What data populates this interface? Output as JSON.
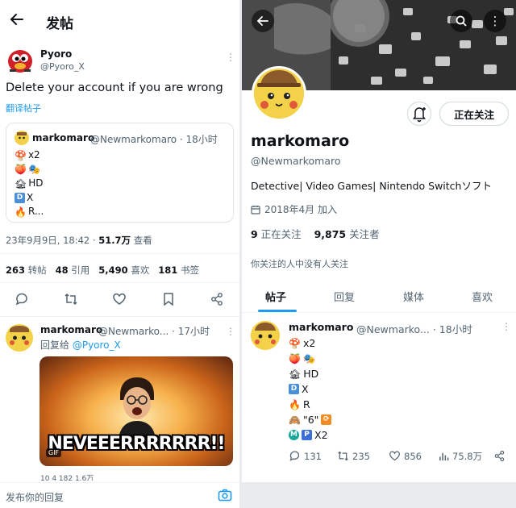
{
  "left": {
    "header": {
      "title": "发帖"
    },
    "tweet": {
      "name": "Pyoro",
      "handle": "@Pyoro_X",
      "text": "Delete your account if you are wrong",
      "translate": "翻译帖子"
    },
    "quote": {
      "name": "markomaro",
      "handle": "@Newmarkomaro · 18小时",
      "lines": [
        {
          "icons": [
            "mushroom"
          ],
          "text": "x2"
        },
        {
          "icons": [
            "peach",
            "masks"
          ],
          "text": ""
        },
        {
          "icons": [
            "house"
          ],
          "text": "HD"
        },
        {
          "icons": [
            "box-d"
          ],
          "text": "X"
        },
        {
          "icons": [
            "fire"
          ],
          "text": "R..."
        }
      ]
    },
    "meta": {
      "datetime": "23年9月9日, 18:42 · ",
      "views": "51.7万",
      "views_label": " 查看"
    },
    "stats": {
      "retweets": "263",
      "retweets_label": " 转帖",
      "quotes": "48",
      "quotes_label": " 引用",
      "likes": "5,490",
      "likes_label": " 喜欢",
      "bookmarks": "181",
      "bookmarks_label": " 书签"
    },
    "reply": {
      "name": "markomaro",
      "handle": "@Newmarko... · 17小时",
      "reply_prefix": "回复给 ",
      "reply_to": "@Pyoro_X",
      "gif_caption": "NEVEEERRRRRRR!!",
      "gif_badge": "GIF",
      "partial_counts": "10        4        182       1.6万"
    },
    "compose_placeholder": "发布你的回复"
  },
  "right": {
    "follow_button": "正在关注",
    "name": "markomaro",
    "handle": "@Newmarkomaro",
    "bio": "Detective| Video Games| Nintendo Switchソフト",
    "joined": "2018年4月 加入",
    "following_count": "9",
    "following_label": " 正在关注",
    "followers_count": "9,875",
    "followers_label": " 关注者",
    "mutual": "你关注的人中没有人关注",
    "tabs": [
      "帖子",
      "回复",
      "媒体",
      "喜欢"
    ],
    "post": {
      "name": "markomaro",
      "handle": "@Newmarko... · 18小时",
      "lines": [
        {
          "icons": [
            "mushroom"
          ],
          "text": "x2"
        },
        {
          "icons": [
            "peach",
            "masks"
          ],
          "text": ""
        },
        {
          "icons": [
            "house"
          ],
          "text": "HD"
        },
        {
          "icons": [
            "box-d"
          ],
          "text": "X"
        },
        {
          "icons": [
            "fire"
          ],
          "text": "R"
        },
        {
          "icons": [
            "monkey"
          ],
          "text": "\"6\""
        },
        {
          "icons": [
            "circle-m",
            "box-p"
          ],
          "text": "X2"
        }
      ],
      "replies": "131",
      "retweets": "235",
      "likes": "856",
      "views": "75.8万"
    }
  },
  "colors": {
    "accent": "#1d9bf0",
    "text": "#0f1419",
    "muted": "#536471"
  }
}
